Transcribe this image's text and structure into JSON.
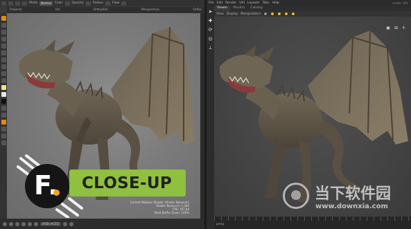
{
  "left_app": {
    "topbar": {
      "mode_label": "Mode",
      "mode_value": "Normal",
      "color_label": "Color",
      "opacity_label": "Opacity",
      "radius_label": "Radius",
      "flow_label": "Flow"
    },
    "tabs": [
      "Projects",
      "UV",
      "Ortho/UV",
      "Perspective",
      "Ortho"
    ],
    "viewport_info": [
      "Current Modular Shader: Shader Network1",
      "Shader Resource: 1,362",
      "FPS: 197.44",
      "Paint Buffer Zoom: 102%"
    ],
    "bottombar": {
      "colorspace_field": "sRGB (ACES)"
    }
  },
  "right_app": {
    "menu": [
      "File",
      "Edit",
      "Render",
      "Util",
      "Layouts",
      "Tabs",
      "Help"
    ],
    "status": "render: Idle",
    "tabs": [
      "Viewer",
      "Monitor",
      "Catalog"
    ],
    "active_tab": "Viewer",
    "subbar": [
      "View",
      "Display",
      "Manipulators"
    ],
    "timeline_label": "persp"
  },
  "badge": {
    "logo_letter": "F.",
    "label": "CLOSE-UP",
    "colors": {
      "banner": "#8fc03f",
      "logo_bg": "#151515",
      "logo_dot": "#f2a51c"
    }
  },
  "watermark": {
    "title": "当下软件园",
    "url": "www.downxia.com"
  }
}
